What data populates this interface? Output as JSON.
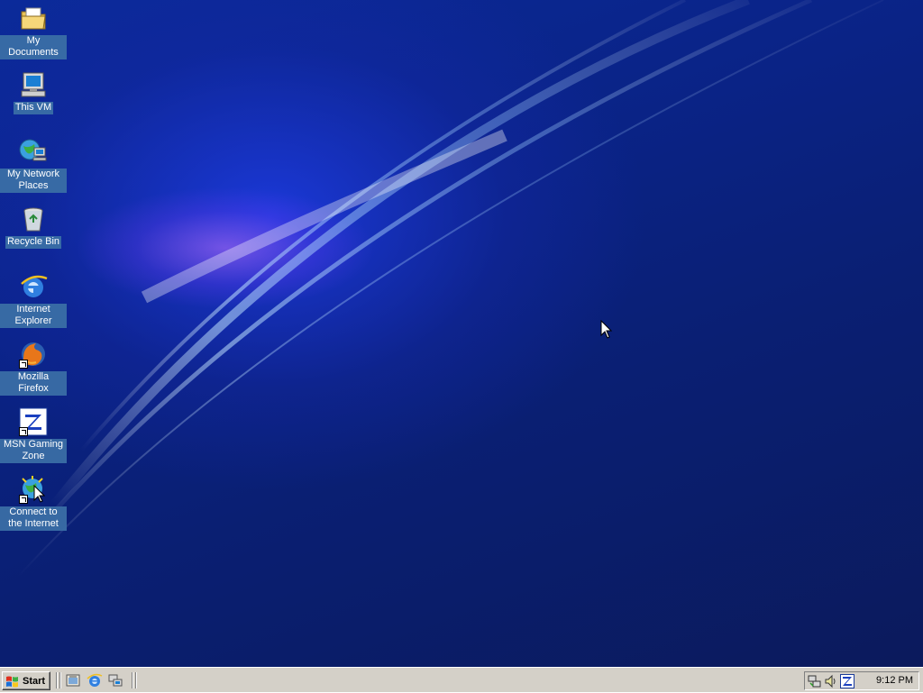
{
  "desktop": {
    "icons": [
      {
        "label": "My Documents"
      },
      {
        "label": "This VM"
      },
      {
        "label": "My Network Places"
      },
      {
        "label": "Recycle Bin"
      },
      {
        "label": "Internet Explorer"
      },
      {
        "label": "Mozilla Firefox"
      },
      {
        "label": "MSN Gaming Zone"
      },
      {
        "label": "Connect to the Internet"
      }
    ]
  },
  "taskbar": {
    "start_label": "Start",
    "quick_launch": [
      {
        "icon": "show-desktop-icon"
      },
      {
        "icon": "internet-explorer-icon"
      },
      {
        "icon": "network-icon"
      }
    ],
    "tray": {
      "icons": [
        "network-connection-icon",
        "volume-icon",
        "msn-zone-icon"
      ],
      "clock": "9:12 PM"
    }
  },
  "colors": {
    "desktop_bg": "#0a2386",
    "taskbar_bg": "#d4d0c8",
    "icon_label_bg": "#3a6ea5"
  }
}
